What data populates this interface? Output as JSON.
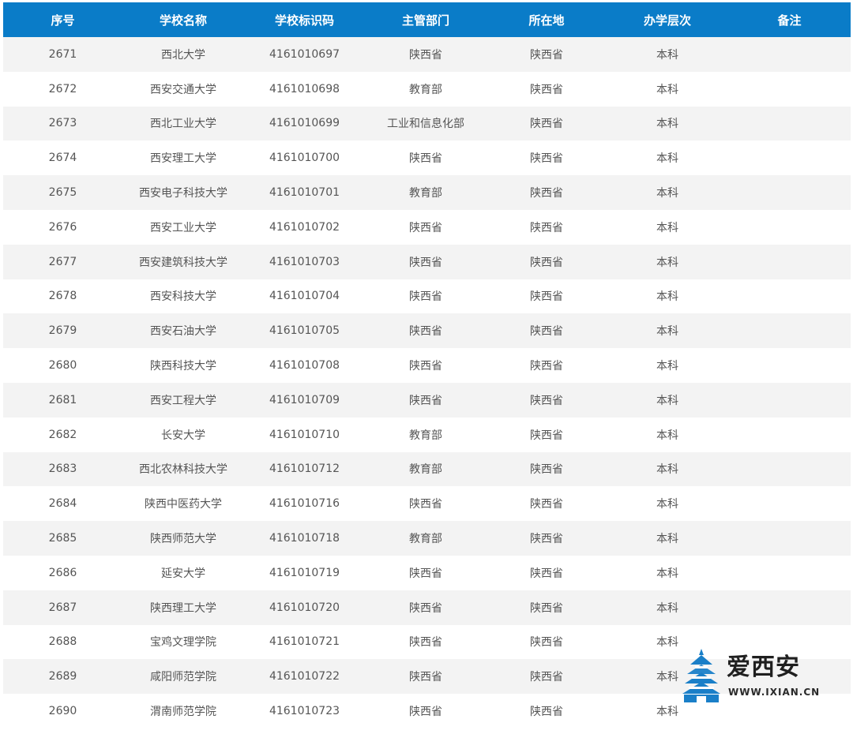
{
  "table": {
    "headers": [
      "序号",
      "学校名称",
      "学校标识码",
      "主管部门",
      "所在地",
      "办学层次",
      "备注"
    ],
    "rows": [
      [
        "2671",
        "西北大学",
        "4161010697",
        "陕西省",
        "陕西省",
        "本科",
        ""
      ],
      [
        "2672",
        "西安交通大学",
        "4161010698",
        "教育部",
        "陕西省",
        "本科",
        ""
      ],
      [
        "2673",
        "西北工业大学",
        "4161010699",
        "工业和信息化部",
        "陕西省",
        "本科",
        ""
      ],
      [
        "2674",
        "西安理工大学",
        "4161010700",
        "陕西省",
        "陕西省",
        "本科",
        ""
      ],
      [
        "2675",
        "西安电子科技大学",
        "4161010701",
        "教育部",
        "陕西省",
        "本科",
        ""
      ],
      [
        "2676",
        "西安工业大学",
        "4161010702",
        "陕西省",
        "陕西省",
        "本科",
        ""
      ],
      [
        "2677",
        "西安建筑科技大学",
        "4161010703",
        "陕西省",
        "陕西省",
        "本科",
        ""
      ],
      [
        "2678",
        "西安科技大学",
        "4161010704",
        "陕西省",
        "陕西省",
        "本科",
        ""
      ],
      [
        "2679",
        "西安石油大学",
        "4161010705",
        "陕西省",
        "陕西省",
        "本科",
        ""
      ],
      [
        "2680",
        "陕西科技大学",
        "4161010708",
        "陕西省",
        "陕西省",
        "本科",
        ""
      ],
      [
        "2681",
        "西安工程大学",
        "4161010709",
        "陕西省",
        "陕西省",
        "本科",
        ""
      ],
      [
        "2682",
        "长安大学",
        "4161010710",
        "教育部",
        "陕西省",
        "本科",
        ""
      ],
      [
        "2683",
        "西北农林科技大学",
        "4161010712",
        "教育部",
        "陕西省",
        "本科",
        ""
      ],
      [
        "2684",
        "陕西中医药大学",
        "4161010716",
        "陕西省",
        "陕西省",
        "本科",
        ""
      ],
      [
        "2685",
        "陕西师范大学",
        "4161010718",
        "教育部",
        "陕西省",
        "本科",
        ""
      ],
      [
        "2686",
        "延安大学",
        "4161010719",
        "陕西省",
        "陕西省",
        "本科",
        ""
      ],
      [
        "2687",
        "陕西理工大学",
        "4161010720",
        "陕西省",
        "陕西省",
        "本科",
        ""
      ],
      [
        "2688",
        "宝鸡文理学院",
        "4161010721",
        "陕西省",
        "陕西省",
        "本科",
        ""
      ],
      [
        "2689",
        "咸阳师范学院",
        "4161010722",
        "陕西省",
        "陕西省",
        "本科",
        ""
      ],
      [
        "2690",
        "渭南师范学院",
        "4161010723",
        "陕西省",
        "陕西省",
        "本科",
        ""
      ]
    ]
  },
  "watermark": {
    "name": "爱西安",
    "url": "WWW.IXIAN.CN",
    "logo_icon": "tiered-pagoda-icon"
  },
  "colors": {
    "header_bg": "#0a7cc8",
    "header_text": "#ffffff",
    "row_stripe": "#f3f3f3",
    "cell_text": "#555555",
    "logo_blue": "#1a7fc8"
  }
}
